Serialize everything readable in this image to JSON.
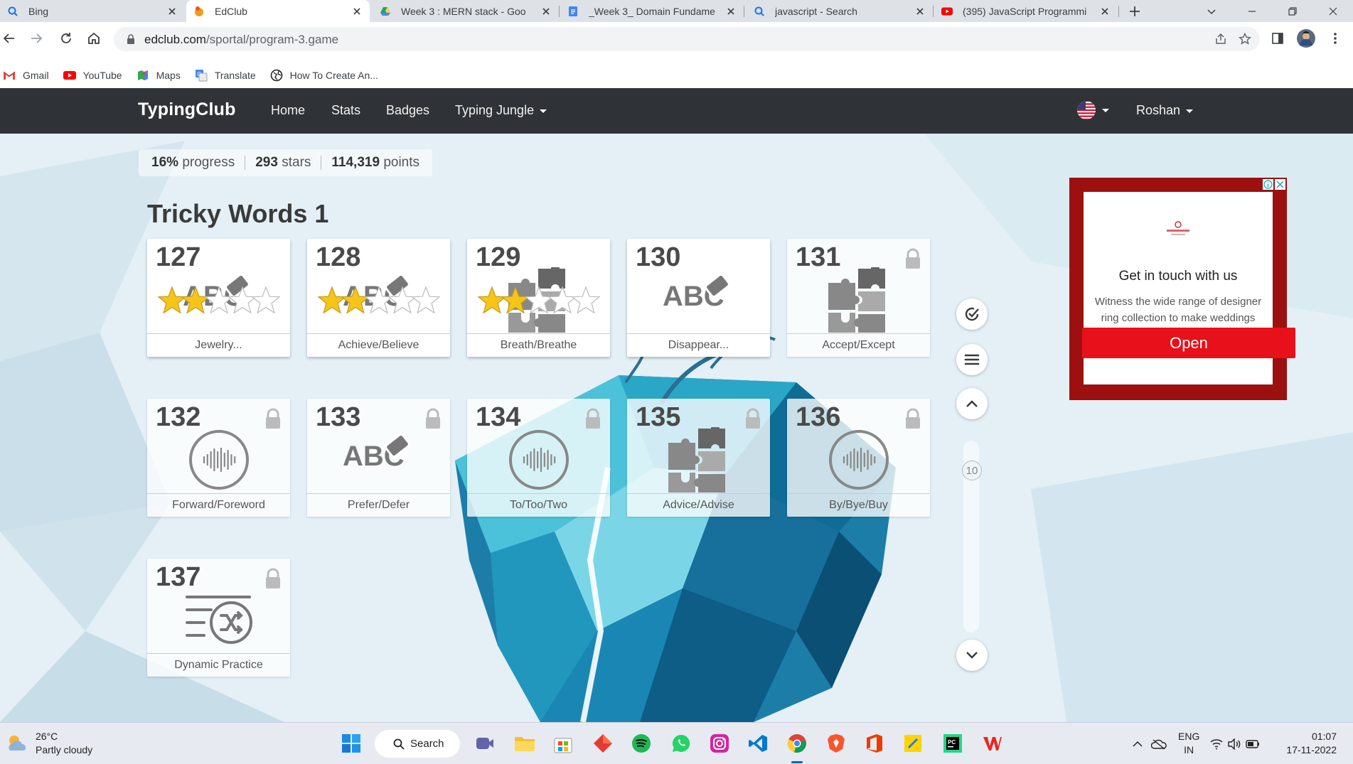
{
  "browser": {
    "tabs": [
      {
        "title": "Bing",
        "icon": "search-icon",
        "active": false
      },
      {
        "title": "EdClub",
        "icon": "edclub-icon",
        "active": true
      },
      {
        "title": "Week 3 : MERN stack - Goo",
        "icon": "google-drive-icon",
        "active": false
      },
      {
        "title": "_Week 3_ Domain Fundame",
        "icon": "google-docs-icon",
        "active": false
      },
      {
        "title": "javascript - Search",
        "icon": "search-icon",
        "active": false
      },
      {
        "title": "(395) JavaScript Programmi",
        "icon": "youtube-icon",
        "active": false
      }
    ],
    "url_domain": "edclub.com",
    "url_path": "/sportal/program-3.game",
    "bookmarks": [
      {
        "label": "Gmail",
        "icon": "gmail-icon"
      },
      {
        "label": "YouTube",
        "icon": "youtube-icon"
      },
      {
        "label": "Maps",
        "icon": "maps-icon"
      },
      {
        "label": "Translate",
        "icon": "translate-icon"
      },
      {
        "label": "How To Create An...",
        "icon": "globe-icon"
      }
    ]
  },
  "nav": {
    "brand": "TypingClub",
    "links": [
      "Home",
      "Stats",
      "Badges",
      "Typing Jungle"
    ],
    "user": "Roshan"
  },
  "progress": {
    "percent_value": "16%",
    "percent_label": "progress",
    "stars_value": "293",
    "stars_label": "stars",
    "points_value": "114,319",
    "points_label": "points"
  },
  "section_title": "Tricky Words 1",
  "lessons": [
    {
      "num": "127",
      "name": "Jewelry...",
      "type": "abc",
      "locked": false,
      "stars": 1.5
    },
    {
      "num": "128",
      "name": "Achieve/Believe",
      "type": "abc",
      "locked": false,
      "stars": 1.5
    },
    {
      "num": "129",
      "name": "Breath/Breathe",
      "type": "puzzle",
      "locked": false,
      "stars": 1.5
    },
    {
      "num": "130",
      "name": "Disappear...",
      "type": "abc",
      "locked": false,
      "stars": 0
    },
    {
      "num": "131",
      "name": "Accept/Except",
      "type": "puzzle",
      "locked": true,
      "stars": 0
    },
    {
      "num": "132",
      "name": "Forward/Foreword",
      "type": "audio",
      "locked": true,
      "stars": 0
    },
    {
      "num": "133",
      "name": "Prefer/Defer",
      "type": "abc",
      "locked": true,
      "stars": 0
    },
    {
      "num": "134",
      "name": "To/Too/Two",
      "type": "audio",
      "locked": true,
      "stars": 0
    },
    {
      "num": "135",
      "name": "Advice/Advise",
      "type": "puzzle",
      "locked": true,
      "stars": 0
    },
    {
      "num": "136",
      "name": "By/Bye/Buy",
      "type": "audio",
      "locked": true,
      "stars": 0
    },
    {
      "num": "137",
      "name": "Dynamic Practice",
      "type": "shuffle",
      "locked": true,
      "stars": 0
    }
  ],
  "scroll_position_label": "10",
  "ad": {
    "brand": "rajakumar",
    "title": "Get in touch with us",
    "text": "Witness the wide range of designer ring collection to make weddings memorable",
    "button": "Open"
  },
  "taskbar": {
    "temperature": "26°C",
    "weather": "Partly cloudy",
    "search": "Search",
    "lang_top": "ENG",
    "lang_bottom": "IN",
    "time": "01:07",
    "date": "17-11-2022"
  },
  "colors": {
    "navbar": "#2f3337",
    "ad_bg": "#9c1010",
    "ad_button": "#e8101a",
    "star": "#f5c518"
  }
}
